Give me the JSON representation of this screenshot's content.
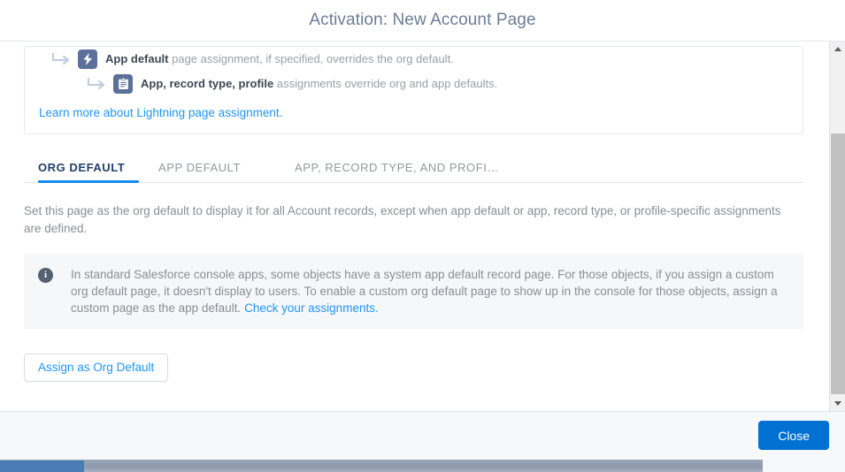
{
  "modal": {
    "title": "Activation: New Account Page"
  },
  "assignment_card": {
    "rows": [
      {
        "icon": "lightning-bolt-icon",
        "bold": "App default",
        "rest": " page assignment, if specified, overrides the org default."
      },
      {
        "icon": "record-page-icon",
        "bold": "App, record type, profile",
        "rest": " assignments override org and app defaults."
      }
    ],
    "learn_more_link": "Learn more about Lightning page assignment."
  },
  "tabs": [
    {
      "label": "ORG DEFAULT",
      "active": true
    },
    {
      "label": "APP DEFAULT",
      "active": false
    },
    {
      "label": "APP, RECORD TYPE, AND PROFI…",
      "active": false
    }
  ],
  "org_default": {
    "description": "Set this page as the org default to display it for all Account records, except when app default or app, record type, or profile-specific assignments are defined.",
    "info_panel": {
      "icon": "info-icon",
      "text": "In standard Salesforce console apps, some objects have a system app default record page. For those objects, if you assign a custom org default page, it doesn't display to users. To enable a custom org default page to show up in the console for those objects, assign a custom page as the app default.",
      "link": "Check your assignments."
    },
    "assign_button": "Assign as Org Default"
  },
  "footer": {
    "close_button": "Close"
  },
  "scrollbar": {
    "up_arrow": "scroll-up-icon",
    "down_arrow": "scroll-down-icon"
  },
  "colors": {
    "brand_blue": "#0070d2",
    "link_blue": "#1b96ff",
    "active_tab_underline": "#1589ee",
    "title_slate": "#6b7c99",
    "icon_slate": "#5c7099",
    "info_bg": "#f6f7f9",
    "footer_bg": "#f7f8f9"
  }
}
